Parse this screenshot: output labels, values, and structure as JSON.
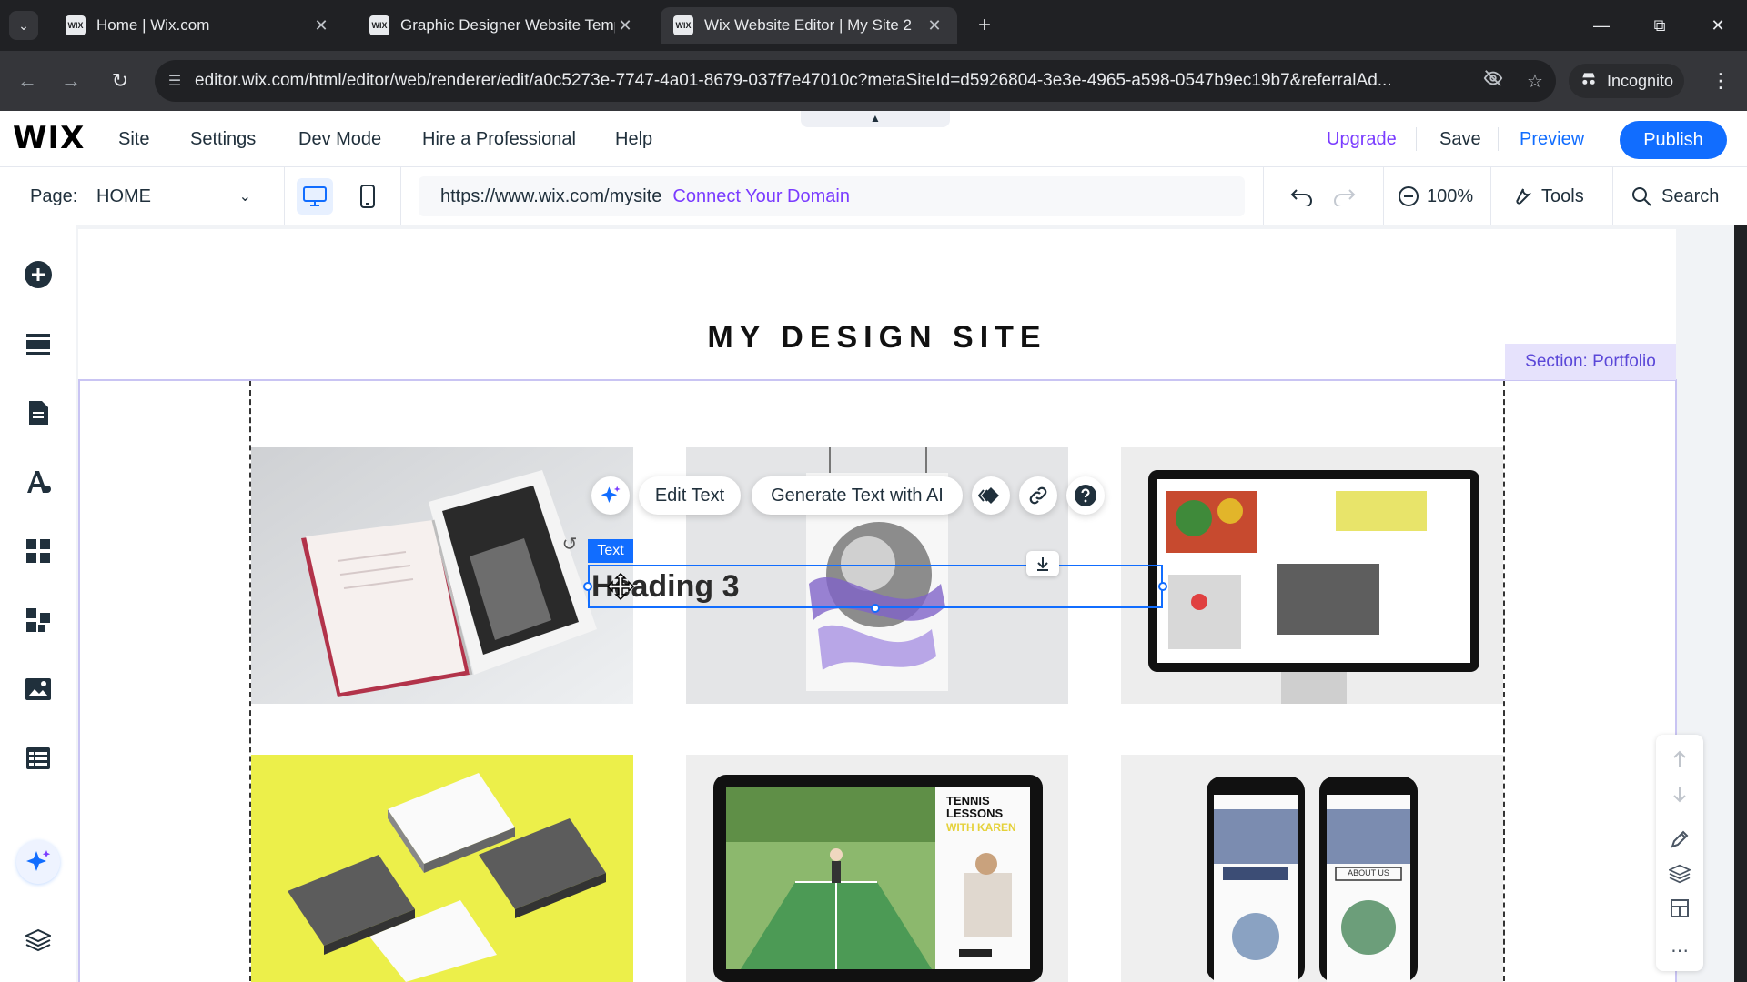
{
  "browser": {
    "tabs": [
      {
        "title": "Home | Wix.com",
        "favicon": "WIX",
        "active": false
      },
      {
        "title": "Graphic Designer Website Temp",
        "favicon": "WIX",
        "active": false
      },
      {
        "title": "Wix Website Editor | My Site 2",
        "favicon": "WIX",
        "active": true
      }
    ],
    "url": "editor.wix.com/html/editor/web/renderer/edit/a0c5273e-7747-4a01-8679-037f7e47010c?metaSiteId=d5926804-3e3e-4965-a598-0547b9ec19b7&referralAd...",
    "incognito_label": "Incognito"
  },
  "editor": {
    "logo": "WIX",
    "menu": [
      "Site",
      "Settings",
      "Dev Mode",
      "Hire a Professional",
      "Help"
    ],
    "upgrade_label": "Upgrade",
    "save_label": "Save",
    "preview_label": "Preview",
    "publish_label": "Publish",
    "page_label": "Page:",
    "page_value": "HOME",
    "site_url": "https://www.wix.com/mysite",
    "connect_domain": "Connect Your Domain",
    "zoom": "100%",
    "tools_label": "Tools",
    "search_label": "Search"
  },
  "canvas": {
    "site_title": "MY DESIGN SITE",
    "section_label": "Section: Portfolio",
    "selected_tag": "Text",
    "selected_text": "Heading 3",
    "edit_text_label": "Edit Text",
    "generate_text_label": "Generate Text with AI",
    "tennis_title": "TENNIS LESSONS",
    "tennis_sub": "WITH KAREN",
    "phone_about": "ABOUT US"
  },
  "colors": {
    "accent": "#116dff",
    "upgrade": "#7a3cff",
    "section": "#c9c4f3",
    "yellow_tile": "#ecef4a"
  }
}
